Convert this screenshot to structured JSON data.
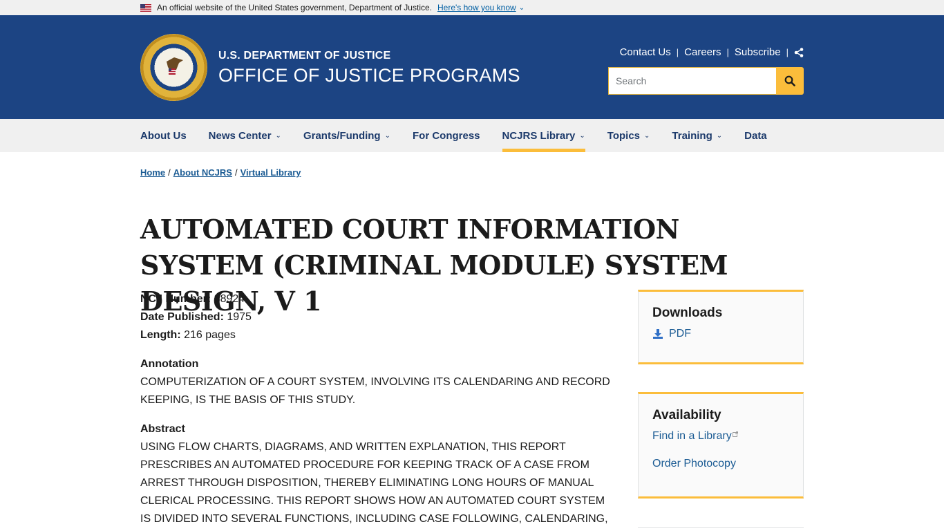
{
  "gov_banner": {
    "text": "An official website of the United States government, Department of Justice.",
    "link": "Here's how you know"
  },
  "header": {
    "department": "U.S. DEPARTMENT OF JUSTICE",
    "office": "OFFICE OF JUSTICE PROGRAMS",
    "util_links": [
      "Contact Us",
      "Careers",
      "Subscribe"
    ],
    "search_placeholder": "Search"
  },
  "nav": {
    "items": [
      {
        "label": "About Us",
        "dropdown": false
      },
      {
        "label": "News Center",
        "dropdown": true
      },
      {
        "label": "Grants/Funding",
        "dropdown": true
      },
      {
        "label": "For Congress",
        "dropdown": false
      },
      {
        "label": "NCJRS Library",
        "dropdown": true,
        "active": true
      },
      {
        "label": "Topics",
        "dropdown": true
      },
      {
        "label": "Training",
        "dropdown": true
      },
      {
        "label": "Data",
        "dropdown": false
      }
    ]
  },
  "breadcrumb": [
    "Home",
    "About NCJRS",
    "Virtual Library"
  ],
  "page": {
    "title": "AUTOMATED COURT INFORMATION SYSTEM (CRIMINAL MODULE) SYSTEM DESIGN, V 1",
    "meta": [
      {
        "label": "NCJ Number:",
        "value": "38924"
      },
      {
        "label": "Date Published:",
        "value": "1975"
      },
      {
        "label": "Length:",
        "value": "216 pages"
      }
    ],
    "annotation_heading": "Annotation",
    "annotation": "COMPUTERIZATION OF A COURT SYSTEM, INVOLVING ITS CALENDARING AND RECORD KEEPING, IS THE BASIS OF THIS STUDY.",
    "abstract_heading": "Abstract",
    "abstract": "USING FLOW CHARTS, DIAGRAMS, AND WRITTEN EXPLANATION, THIS REPORT PRESCRIBES AN AUTOMATED PROCEDURE FOR KEEPING TRACK OF A CASE FROM ARREST THROUGH DISPOSITION, THEREBY ELIMINATING LONG HOURS OF MANUAL CLERICAL PROCESSING. THIS REPORT SHOWS HOW AN AUTOMATED COURT SYSTEM IS DIVIDED INTO SEVERAL FUNCTIONS, INCLUDING CASE FOLLOWING, CALENDARING,"
  },
  "sidebar": {
    "downloads": {
      "heading": "Downloads",
      "links": [
        "PDF"
      ]
    },
    "availability": {
      "heading": "Availability",
      "links": [
        "Find in a Library",
        "Order Photocopy"
      ]
    }
  },
  "colors": {
    "header_bg": "#1c4483",
    "accent_gold": "#fbbd3b",
    "nav_text": "#1c3a6b",
    "link": "#1c5c94"
  }
}
